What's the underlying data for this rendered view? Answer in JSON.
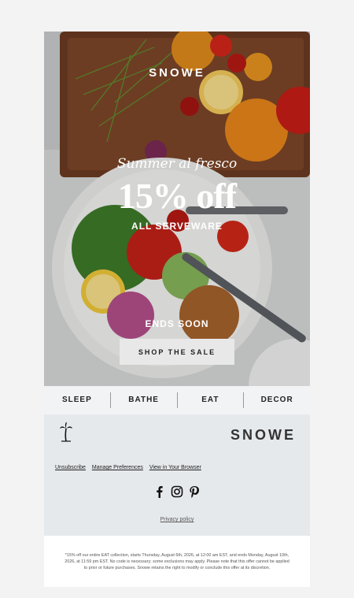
{
  "hero": {
    "brand": "SNOWE",
    "script_heading": "Summer al fresco",
    "headline": "15% off",
    "subheadline": "ALL SERVEWARE",
    "ends_text": "ENDS SOON",
    "cta_label": "SHOP THE SALE"
  },
  "nav": {
    "items": [
      {
        "label": "SLEEP"
      },
      {
        "label": "BATHE"
      },
      {
        "label": "EAT"
      },
      {
        "label": "DECOR"
      }
    ]
  },
  "footer": {
    "logo": "SNOWE",
    "palm_icon": "palm-tree-icon",
    "links": [
      "Unsubscribe",
      "Manage Preferences",
      "View in Your Browser"
    ],
    "social": [
      "facebook-icon",
      "instagram-icon",
      "pinterest-icon"
    ],
    "privacy": "Privacy policy"
  },
  "disclaimer": "*15% off our entire EAT collection, starts Thursday, August 6th, 2026, at 12:00 am EST, and ends Monday, August 10th, 2026, at 11:59 pm EST. No code is necessary; some exclusions may apply. Please note that this offer cannot be applied to prior or future purchases. Snowe retains the right to modify or conclude this offer at its discretion.",
  "colors": {
    "page_bg": "#f3f3f3",
    "nav_bg": "#f1f3f5",
    "footer_bg": "#e6e9ec",
    "cta_bg": "#e8e8e8"
  }
}
